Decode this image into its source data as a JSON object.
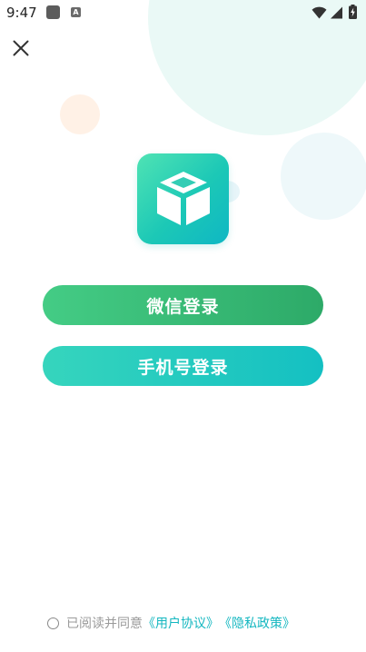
{
  "status_bar": {
    "time": "9:47",
    "a_icon_letter": "A",
    "icons": [
      "app-icon",
      "a-icon",
      "wifi-icon",
      "signal-icon",
      "battery-icon"
    ]
  },
  "header": {
    "close_icon": "close-icon"
  },
  "logo": {
    "icon": "box-icon",
    "colors": [
      "#4fe3b4",
      "#0fb7c4"
    ]
  },
  "buttons": {
    "wechat_label": "微信登录",
    "phone_label": "手机号登录"
  },
  "agreement": {
    "text": "已阅读并同意",
    "user_agreement": "《用户协议》",
    "privacy_policy": "《隐私政策》"
  },
  "colors": {
    "wechat_green": "#3cbf7a",
    "phone_teal": "#20c8c0",
    "link": "#14b7c0"
  }
}
